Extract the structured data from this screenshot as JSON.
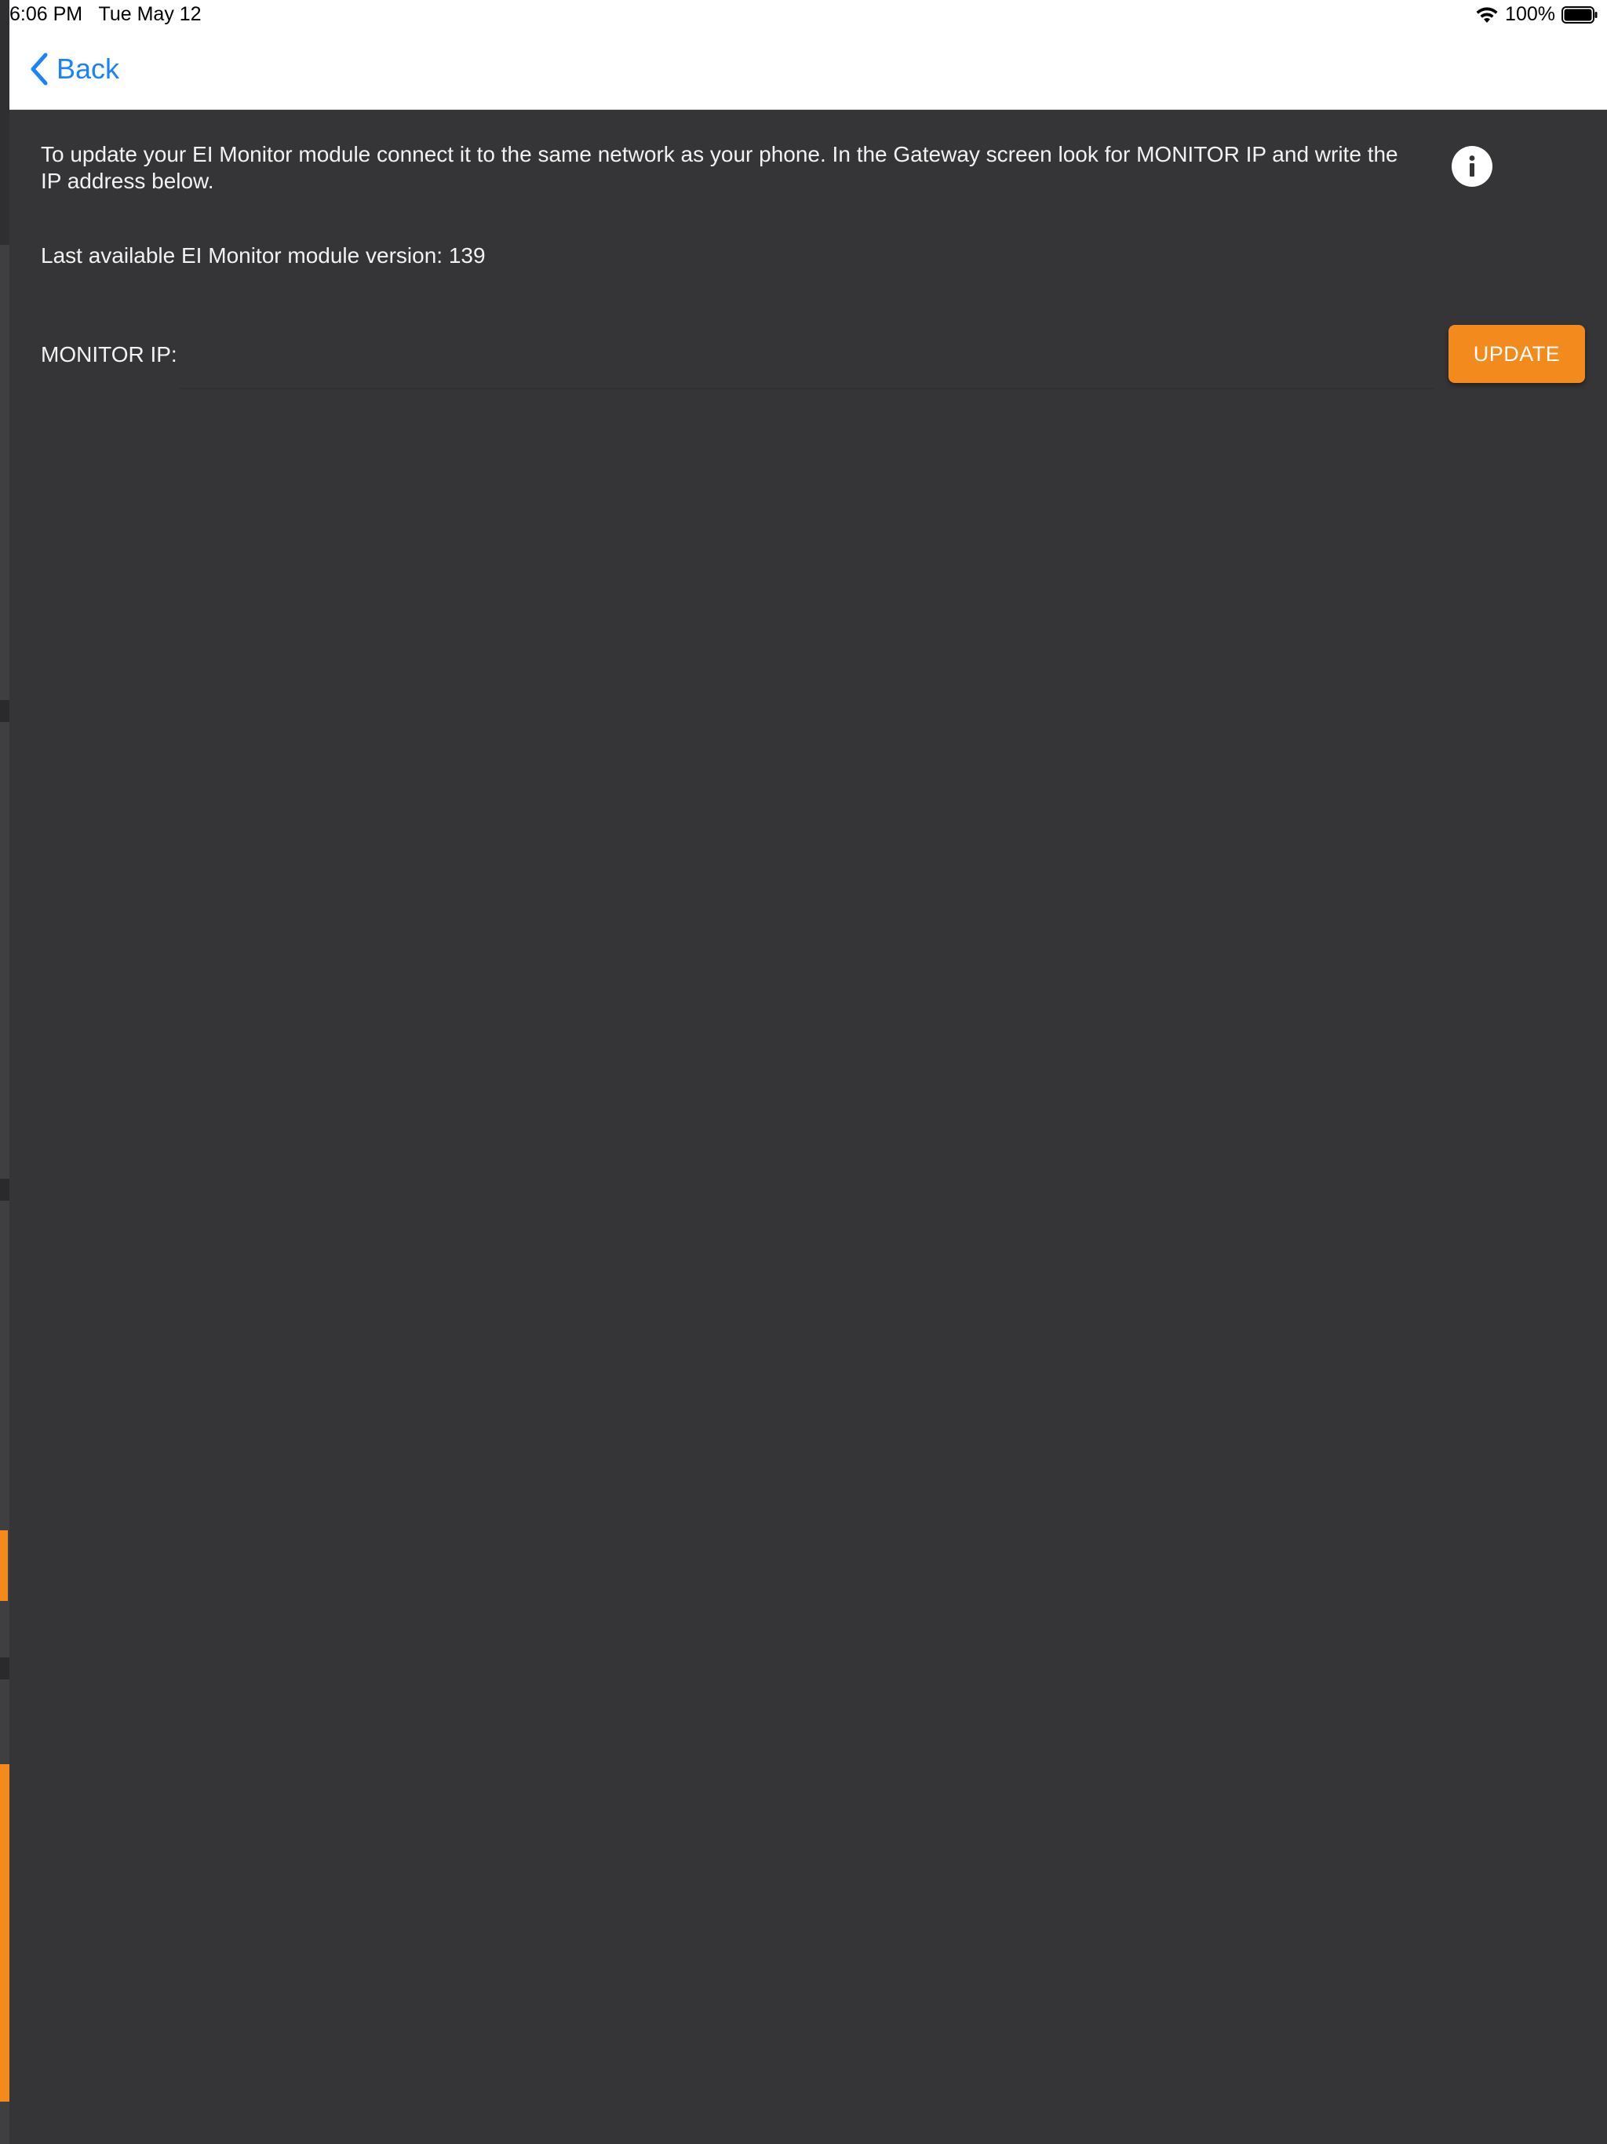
{
  "status_bar": {
    "time": "6:06 PM",
    "date": "Tue May 12",
    "battery": "100%",
    "wifi_icon": "wifi-icon",
    "battery_icon": "battery-icon"
  },
  "nav": {
    "back_label": "Back",
    "back_icon": "chevron-left-icon"
  },
  "content": {
    "instructions": "To update your EI Monitor module connect it to the same network as your phone. In the Gateway screen look for MONITOR IP and write the IP address below.",
    "version_text": "Last available EI Monitor module version: 139",
    "ip_label": "MONITOR IP:",
    "ip_value": "",
    "ip_placeholder": "",
    "update_label": "UPDATE",
    "info_icon": "info-icon"
  },
  "colors": {
    "background": "#353537",
    "accent": "#f28a1e",
    "link": "#1a82fb"
  }
}
